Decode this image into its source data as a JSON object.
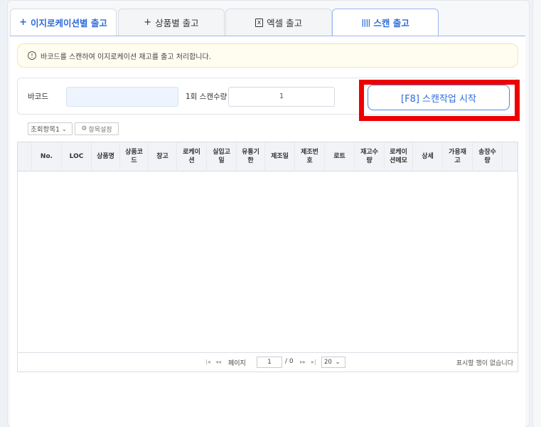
{
  "tabs": [
    {
      "icon": "+",
      "label": "이지로케이션별 출고"
    },
    {
      "icon": "+",
      "label": "상품별 출고"
    },
    {
      "icon": "x",
      "label": "엑셀 출고"
    },
    {
      "icon": "||||",
      "label": "스캔 출고"
    }
  ],
  "notice": {
    "icon": "!",
    "text": "바코드를 스캔하여 이지로케이션 재고를 출고 처리합니다."
  },
  "scan": {
    "barcode_label": "바코드",
    "qty_label": "1회 스캔수량",
    "qty_value": "1",
    "start_button": "[F8] 스캔작업 시작"
  },
  "toolbar": {
    "field_select": "조회항목1",
    "field_setting": "항목설정",
    "chevron": "⌄",
    "gear": "⚙"
  },
  "grid": {
    "columns": [
      "No.",
      "LOC",
      "상품명",
      "상품코\n드",
      "창고",
      "로케이\n션",
      "실입고\n일",
      "유통기\n한",
      "제조일",
      "제조번\n호",
      "로트",
      "재고수\n량",
      "로케이\n션메모",
      "상세",
      "가용재\n고",
      "송장수\n량"
    ]
  },
  "pager": {
    "first": "|◂",
    "prev": "◂◂",
    "page_label": "페이지",
    "page_value": "1",
    "total": "/ 0",
    "next": "▸▸",
    "last": "▸|",
    "page_size": "20",
    "empty_message": "표시할 행이 없습니다"
  }
}
